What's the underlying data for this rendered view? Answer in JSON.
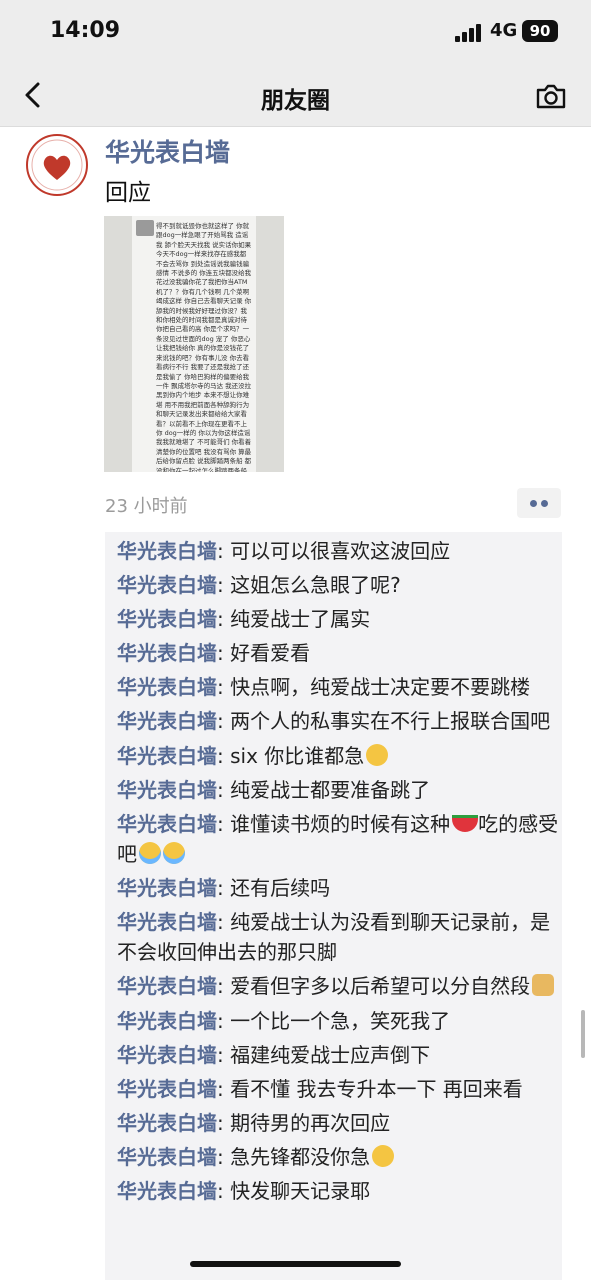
{
  "status": {
    "time": "14:09",
    "network": "4G",
    "battery": "90"
  },
  "nav": {
    "title": "朋友圈"
  },
  "post": {
    "poster": "华光表白墙",
    "text": "回应",
    "time_ago": "23 小时前",
    "image_text": "得不到就诋毁你也就这样了 你就跟dog一样急眼了开始骂我 造谣我 舔个脸天天找我 说实话你如果今天不dog一样来找存在感我都不会去骂你 到处造谣说我骗钱骗感情 不说多的 你连五块都没给我花过没我骗你花了我把你当ATM机了？？你有几个钱啊 几个菜啊 竭成这样 你自己去看聊天记录 你舔我的时候我好好理过你没？我和你相处的时间我都是真诚对待 你把自己看的高 你是个求吗？一条没见过世面的dog 宠了 你恶心让我把钱给你 真的你是没钱花了来讹钱的吧？你有事儿没 你去看看病行不行 我要了还是我抢了还是我偷了 你哈巴狗样的偏要给我一件 飘成塔尔寺的马达 我还没拉黑到你内个地步 本来不想让你难堪 用不用我把前面各种舔狗行为和聊天记录发出来都给给大家看看？以前看不上你现在更看不上你 dog一样的 你以为你这样造谣我我就难堪了 不可能哥们 你看着清楚你的位置吧 我没有骂你 算最后给你留点脸 说我脚踏两条船 都没和你在一起过怎么脚踏两条船 什么时候的事还在这纠缠"
  },
  "comments": [
    {
      "name": "华光表白墙",
      "text": ": 可以可以很喜欢这波回应",
      "emoji": []
    },
    {
      "name": "华光表白墙",
      "text": ": 这姐怎么急眼了呢?",
      "emoji": []
    },
    {
      "name": "华光表白墙",
      "text": ": 纯爱战士了属实",
      "emoji": []
    },
    {
      "name": "华光表白墙",
      "text": ": 好看爱看",
      "emoji": []
    },
    {
      "name": "华光表白墙",
      "text": ": 快点啊，纯爱战士决定要不要跳楼",
      "emoji": []
    },
    {
      "name": "华光表白墙",
      "text": ": 两个人的私事实在不行上报联合国吧",
      "emoji": []
    },
    {
      "name": "华光表白墙",
      "text": ": six 你比谁都急",
      "emoji": [
        "sweat-666-emoji"
      ]
    },
    {
      "name": "华光表白墙",
      "text": ": 纯爱战士都要准备跳了",
      "emoji": []
    },
    {
      "name": "华光表白墙",
      "text": ": 谁懂读书烦的时候有这种",
      "emoji": [
        "watermelon-emoji"
      ],
      "text2": "吃的感受吧",
      "emoji2": [
        "crying-emoji",
        "crying-emoji"
      ]
    },
    {
      "name": "华光表白墙",
      "text": ": 还有后续吗",
      "emoji": []
    },
    {
      "name": "华光表白墙",
      "text": ": 纯爱战士认为没看到聊天记录前，是不会收回伸出去的那只脚",
      "emoji": []
    },
    {
      "name": "华光表白墙",
      "text": ": 爱看但字多以后希望可以分自然段",
      "emoji": [
        "doge-emoji"
      ]
    },
    {
      "name": "华光表白墙",
      "text": ": 一个比一个急，笑死我了",
      "emoji": []
    },
    {
      "name": "华光表白墙",
      "text": ": 福建纯爱战士应声倒下",
      "emoji": []
    },
    {
      "name": "华光表白墙",
      "text": ": 看不懂 我去专升本一下 再回来看",
      "emoji": []
    },
    {
      "name": "华光表白墙",
      "text": ": 期待男的再次回应",
      "emoji": []
    },
    {
      "name": "华光表白墙",
      "text": ": 急先锋都没你急",
      "emoji": [
        "rofl-emoji"
      ]
    },
    {
      "name": "华光表白墙",
      "text": ": 快发聊天记录耶",
      "emoji": []
    }
  ]
}
